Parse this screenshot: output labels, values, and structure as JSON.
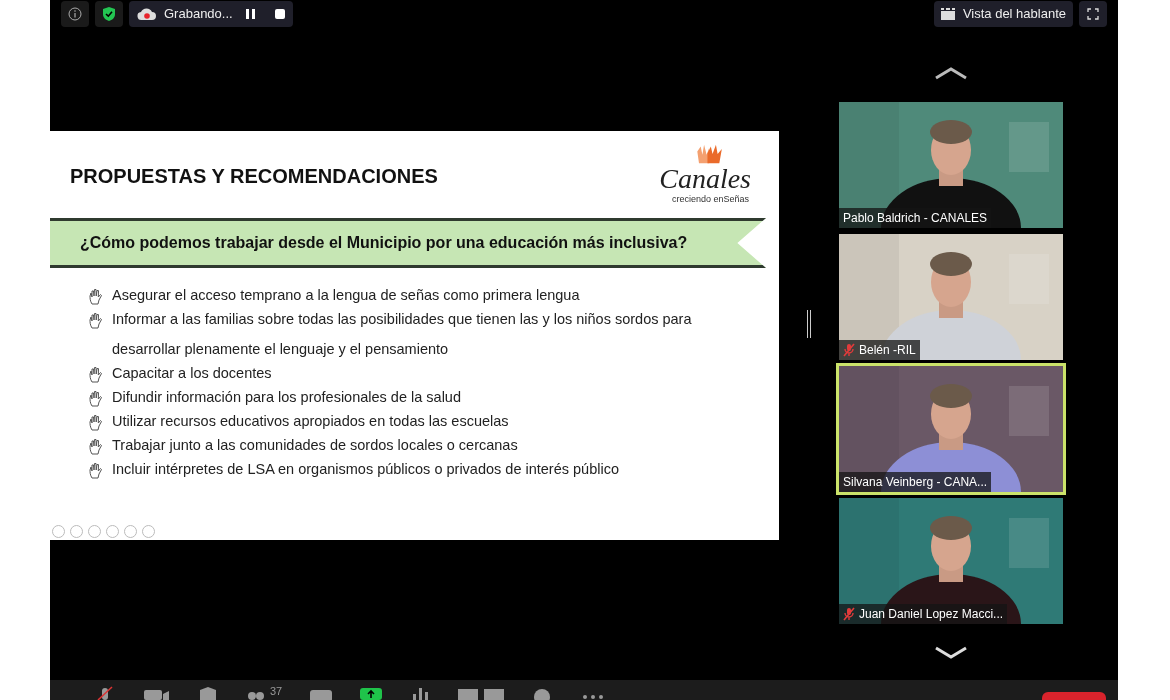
{
  "top_bar": {
    "recording": {
      "label": "Grabando..."
    },
    "view_button": {
      "label": "Vista del hablante"
    }
  },
  "slide": {
    "title": "PROPUESTAS Y RECOMENDACIONES",
    "logo": {
      "name": "Canales",
      "tagline": "creciendo enSeñas"
    },
    "banner": "¿Cómo podemos trabajar desde el Municipio por una educación más inclusiva?",
    "bullets": [
      "Asegurar el acceso temprano a la lengua de señas como primera lengua",
      "Informar a las familias sobre todas las posibilidades que tienen las y los niños sordos para desarrollar plenamente el lenguaje y el pensamiento",
      "Capacitar a los docentes",
      "Difundir información para los profesionales de la salud",
      "Utilizar recursos educativos apropiados en todas las escuelas",
      "Trabajar junto a las comunidades de sordos locales o cercanas",
      "Incluir intérpretes de LSA en organismos públicos o privados de interés público"
    ]
  },
  "participants": [
    {
      "name": "Pablo Baldrich - CANALES",
      "muted": false,
      "speaking": false,
      "color": "#4f8a7a"
    },
    {
      "name": "Belén -RIL",
      "muted": true,
      "speaking": false,
      "color": "#d8d2c6"
    },
    {
      "name": "Silvana Veinberg - CANA...",
      "muted": false,
      "speaking": true,
      "color": "#6a5866"
    },
    {
      "name": "Juan Daniel Lopez Macci...",
      "muted": true,
      "speaking": false,
      "color": "#2f7a76"
    }
  ],
  "toolbar": {
    "participant_count": "37"
  }
}
